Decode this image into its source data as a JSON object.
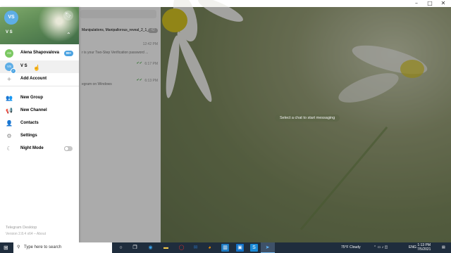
{
  "window": {
    "controls": [
      "–",
      "□",
      "✕"
    ]
  },
  "chat_list": {
    "rows": [
      {
        "line1": "Manipulations, Manipallorous_reveal_2_1_p...",
        "line2": "",
        "time": "",
        "badge": "42"
      },
      {
        "line1": "",
        "line2": "r is your Two-Step Verification password ...",
        "time": "12:42 PM",
        "badge": ""
      },
      {
        "line1": "",
        "line2": "",
        "time": "6:17 PM",
        "badge": "",
        "check": "✔✔"
      },
      {
        "line1": "",
        "line2": "",
        "time": "6:13 PM",
        "badge": "",
        "check": "✔✔"
      },
      {
        "line1": "",
        "line2": "egram on Windows",
        "time": "",
        "badge": ""
      }
    ]
  },
  "chat_area": {
    "empty_hint": "Select a chat to start messaging"
  },
  "drawer": {
    "header": {
      "avatar_initials": "VS",
      "name": "V S"
    },
    "accounts": [
      {
        "initials": "AS",
        "name": "Alena Shapovalova",
        "badge": "99+",
        "color": "#7bc862"
      },
      {
        "initials": "VS",
        "name": "V S",
        "color": "#5eaee6"
      }
    ],
    "add_account": "Add Account",
    "menu": [
      {
        "icon": "group-icon",
        "glyph": "👥",
        "label": "New Group"
      },
      {
        "icon": "megaphone-icon",
        "glyph": "📢",
        "label": "New Channel"
      },
      {
        "icon": "contacts-icon",
        "glyph": "👤",
        "label": "Contacts"
      },
      {
        "icon": "gear-icon",
        "glyph": "⚙",
        "label": "Settings"
      },
      {
        "icon": "moon-icon",
        "glyph": "☾",
        "label": "Night Mode"
      }
    ],
    "footer": {
      "title": "Telegram Desktop",
      "version": "Version 2.8.4 x64 – About"
    }
  },
  "taskbar": {
    "search_placeholder": "Type here to search",
    "weather": "75°F  Cloudy",
    "language": "ENG",
    "time": "1:13 PM",
    "date": "7/5/2021"
  },
  "colors": {
    "accent": "#4ba3e2",
    "drawer_header": "#5e8b55",
    "taskbar": "#1f2d3d"
  }
}
